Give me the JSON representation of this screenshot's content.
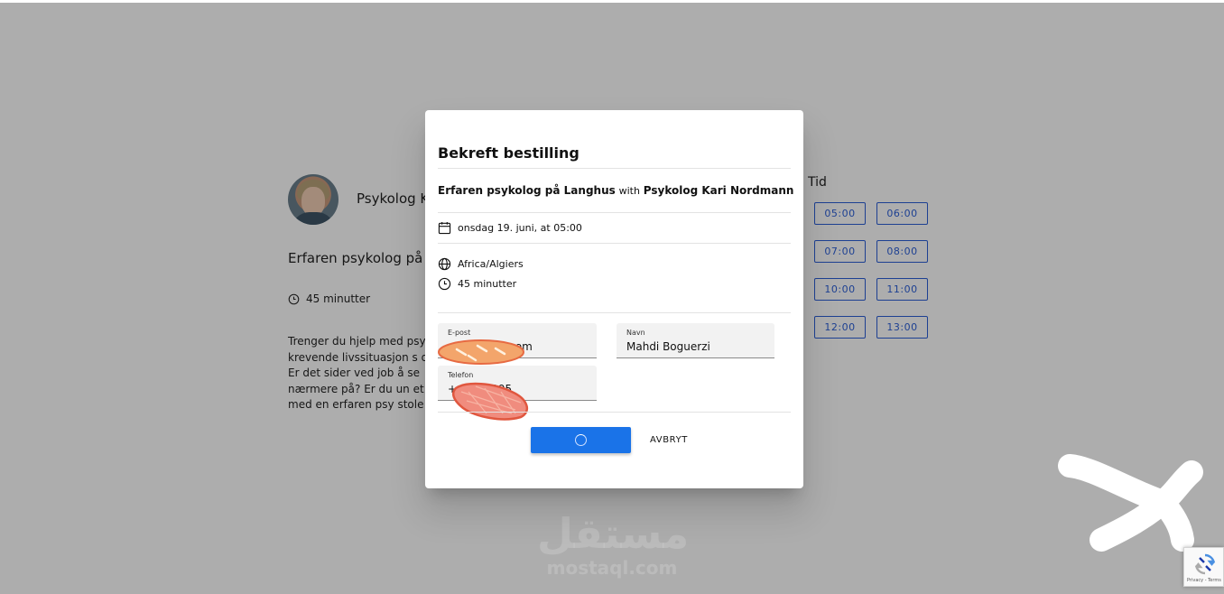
{
  "background": {
    "psychologist_name": "Psykolog Ka",
    "service_title": "Erfaren psykolog på L",
    "duration": "45 minutter",
    "description": "Trenger du hjelp med psyki en krevende livssituasjon s drøfte? Er det sider ved job å se nærmere på? Er du un et møte med en erfaren psy stole på.",
    "time_label": "Tid",
    "time_slots": [
      "05:00",
      "06:00",
      "07:00",
      "08:00",
      "10:00",
      "11:00",
      "12:00",
      "13:00"
    ]
  },
  "dialog": {
    "title": "Bekreft bestilling",
    "service": "Erfaren psykolog på Langhus",
    "with_word": "with",
    "psychologist": "Psykolog Kari Nordmann",
    "date_time": "onsdag 19. juni, at 05:00",
    "timezone": "Africa/Algiers",
    "duration": "45 minutter",
    "email": {
      "label": "E-post",
      "value": "...4@gmail.com"
    },
    "name": {
      "label": "Navn",
      "value": "Mahdi Boguerzi"
    },
    "phone": {
      "label": "Telefon",
      "value": "+...76...295"
    },
    "submit_state": "loading",
    "cancel_label": "AVBRYT"
  },
  "watermark": {
    "arabic": "مستقل",
    "latin": "mostaql.com"
  },
  "recaptcha": {
    "links": "Privacy - Terms"
  },
  "colors": {
    "accent": "#1a73e8",
    "slot_border": "#2c5fd8",
    "overlay": "rgba(0,0,0,0.32)"
  }
}
